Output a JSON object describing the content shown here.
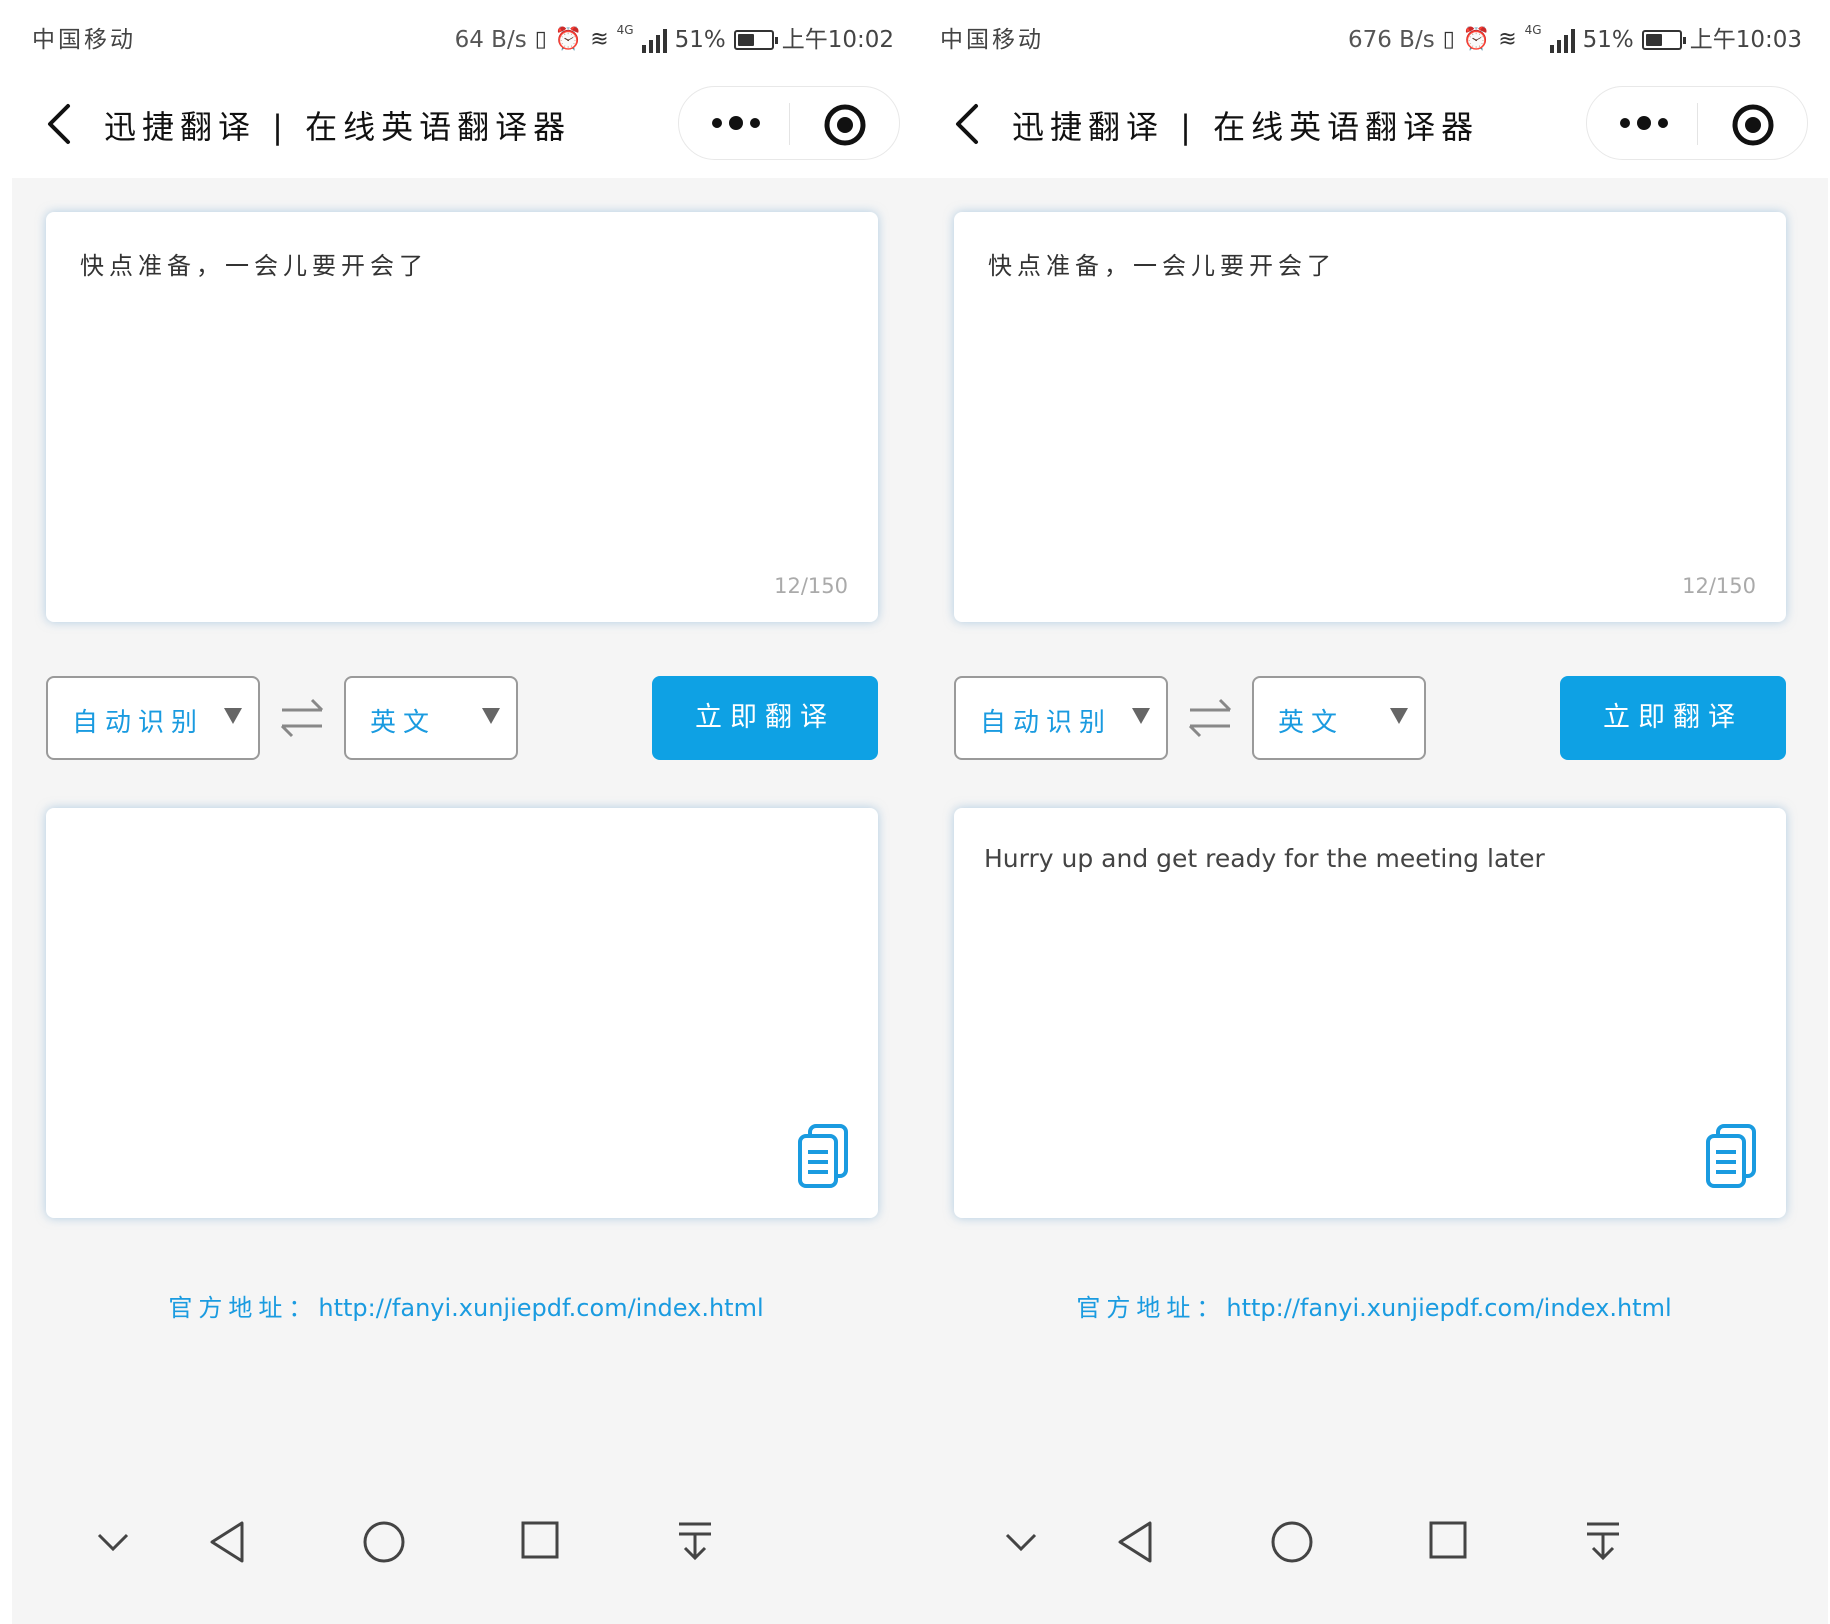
{
  "screens": [
    {
      "status": {
        "carrier": "中国移动",
        "speed": "64 B/s",
        "network": "4G",
        "battery": "51%",
        "battery_level": 0.51,
        "time": "上午10:02"
      },
      "titlebar": {
        "title": "迅捷翻译 | 在线英语翻译器"
      },
      "input": {
        "text": "快点准备，一会儿要开会了",
        "counter": "12/150"
      },
      "controls": {
        "source_lang": "自动识别",
        "target_lang": "英文",
        "translate_label": "立即翻译"
      },
      "output": {
        "text": ""
      },
      "footer": {
        "label": "官方地址：",
        "url": "http://fanyi.xunjiepdf.com/index.html"
      }
    },
    {
      "status": {
        "carrier": "中国移动",
        "speed": "676 B/s",
        "network": "4G",
        "battery": "51%",
        "battery_level": 0.51,
        "time": "上午10:03"
      },
      "titlebar": {
        "title": "迅捷翻译 | 在线英语翻译器"
      },
      "input": {
        "text": "快点准备，一会儿要开会了",
        "counter": "12/150"
      },
      "controls": {
        "source_lang": "自动识别",
        "target_lang": "英文",
        "translate_label": "立即翻译"
      },
      "output": {
        "text": "Hurry up and get ready for the meeting later"
      },
      "footer": {
        "label": "官方地址：",
        "url": "http://fanyi.xunjiepdf.com/index.html"
      }
    }
  ],
  "colors": {
    "accent": "#0ea1e4",
    "link": "#1a9be0",
    "page_bg": "#f5f5f5"
  },
  "icons": {
    "back": "chevron-left-icon",
    "more": "more-dots-icon",
    "close": "target-circle-icon",
    "swap": "swap-arrows-icon",
    "copy": "copy-document-icon",
    "nav": [
      "chevron-down-icon",
      "back-triangle-icon",
      "home-circle-icon",
      "recents-square-icon",
      "pull-down-icon"
    ]
  }
}
